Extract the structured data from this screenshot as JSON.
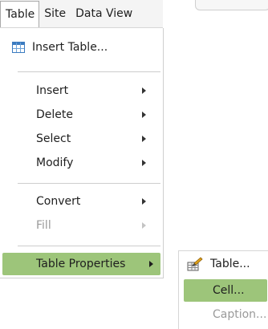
{
  "menubar": {
    "items": [
      {
        "label": "Table",
        "active": true
      },
      {
        "label": "Site"
      },
      {
        "label": "Data View"
      }
    ]
  },
  "table_menu": {
    "items": [
      {
        "label": "Insert Table...",
        "icon": "table-icon"
      },
      {
        "label": "Insert",
        "has_submenu": true
      },
      {
        "label": "Delete",
        "has_submenu": true
      },
      {
        "label": "Select",
        "has_submenu": true
      },
      {
        "label": "Modify",
        "has_submenu": true
      },
      {
        "label": "Convert",
        "has_submenu": true
      },
      {
        "label": "Fill",
        "has_submenu": true,
        "disabled": true
      },
      {
        "label": "Table Properties",
        "has_submenu": true,
        "highlighted": true
      }
    ]
  },
  "table_properties_submenu": {
    "items": [
      {
        "label": "Table...",
        "icon": "table-properties-icon"
      },
      {
        "label": "Cell...",
        "highlighted": true
      },
      {
        "label": "Caption...",
        "disabled": true
      }
    ]
  },
  "colors": {
    "highlight": "#9dc57a",
    "disabled_text": "#9a9a9a"
  }
}
